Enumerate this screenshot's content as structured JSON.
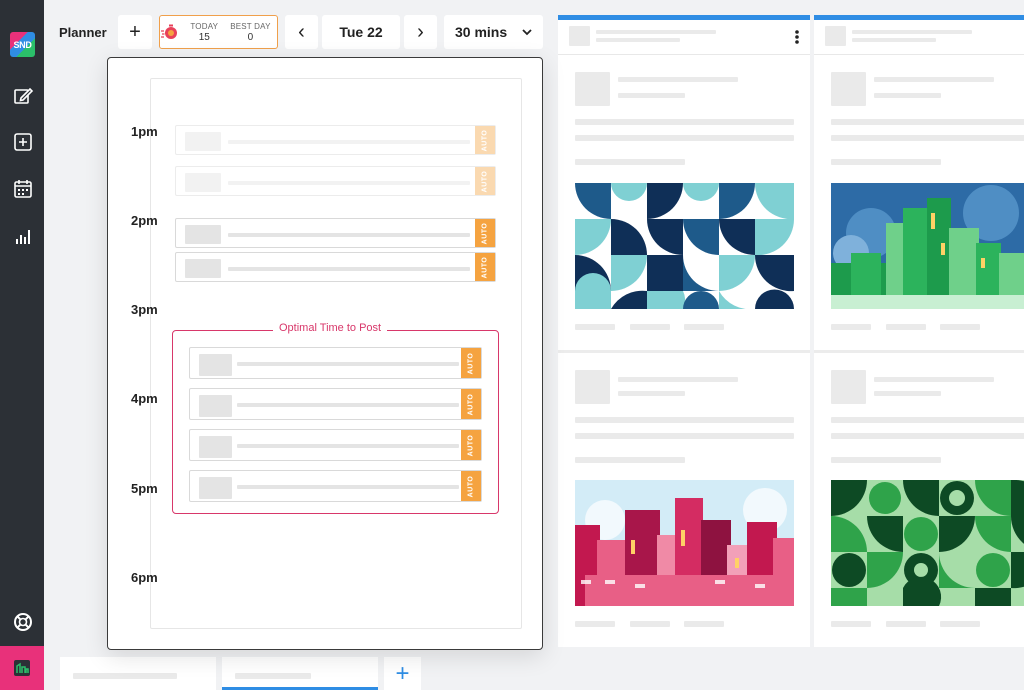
{
  "app": {
    "logo_text": "SND"
  },
  "sidebar": {
    "items": [
      {
        "icon": "compose-icon"
      },
      {
        "icon": "add-box-icon"
      },
      {
        "icon": "calendar-icon"
      },
      {
        "icon": "analytics-icon"
      }
    ],
    "help_icon": "help-icon",
    "bottom_icon": "brand-icon"
  },
  "topbar": {
    "title": "Planner",
    "add_label": "+",
    "stats": {
      "today_label": "TODAY",
      "today_value": "15",
      "best_label": "BEST DAY",
      "best_value": "0"
    },
    "prev_label": "‹",
    "date": "Tue 22",
    "next_label": "›",
    "duration": "30 mins",
    "duration_caret": "⌄"
  },
  "planner": {
    "hours": [
      "1pm",
      "2pm",
      "3pm",
      "4pm",
      "5pm",
      "6pm"
    ],
    "auto_label": "AUTO",
    "optimal_label": "Optimal Time to Post"
  },
  "bottom_tabs": {
    "add_label": "+"
  },
  "colors": {
    "accent": "#2f8de4",
    "brand": "#e8317a",
    "auto": "#f5a340",
    "optimal": "#d8376a"
  }
}
